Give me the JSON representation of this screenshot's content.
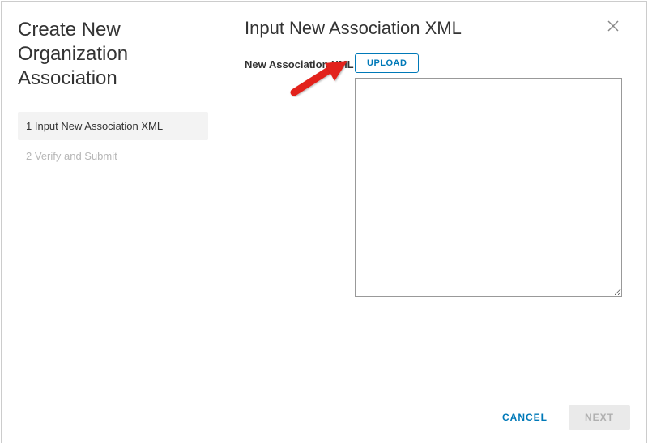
{
  "sidebar": {
    "title": "Create New Organization Association",
    "steps": [
      {
        "num": "1",
        "label": "Input New Association XML",
        "active": true
      },
      {
        "num": "2",
        "label": "Verify and Submit",
        "active": false
      }
    ]
  },
  "main": {
    "title": "Input New Association XML",
    "form_label": "New Association XML",
    "upload_label": "UPLOAD",
    "textarea_value": ""
  },
  "footer": {
    "cancel_label": "CANCEL",
    "next_label": "NEXT"
  }
}
